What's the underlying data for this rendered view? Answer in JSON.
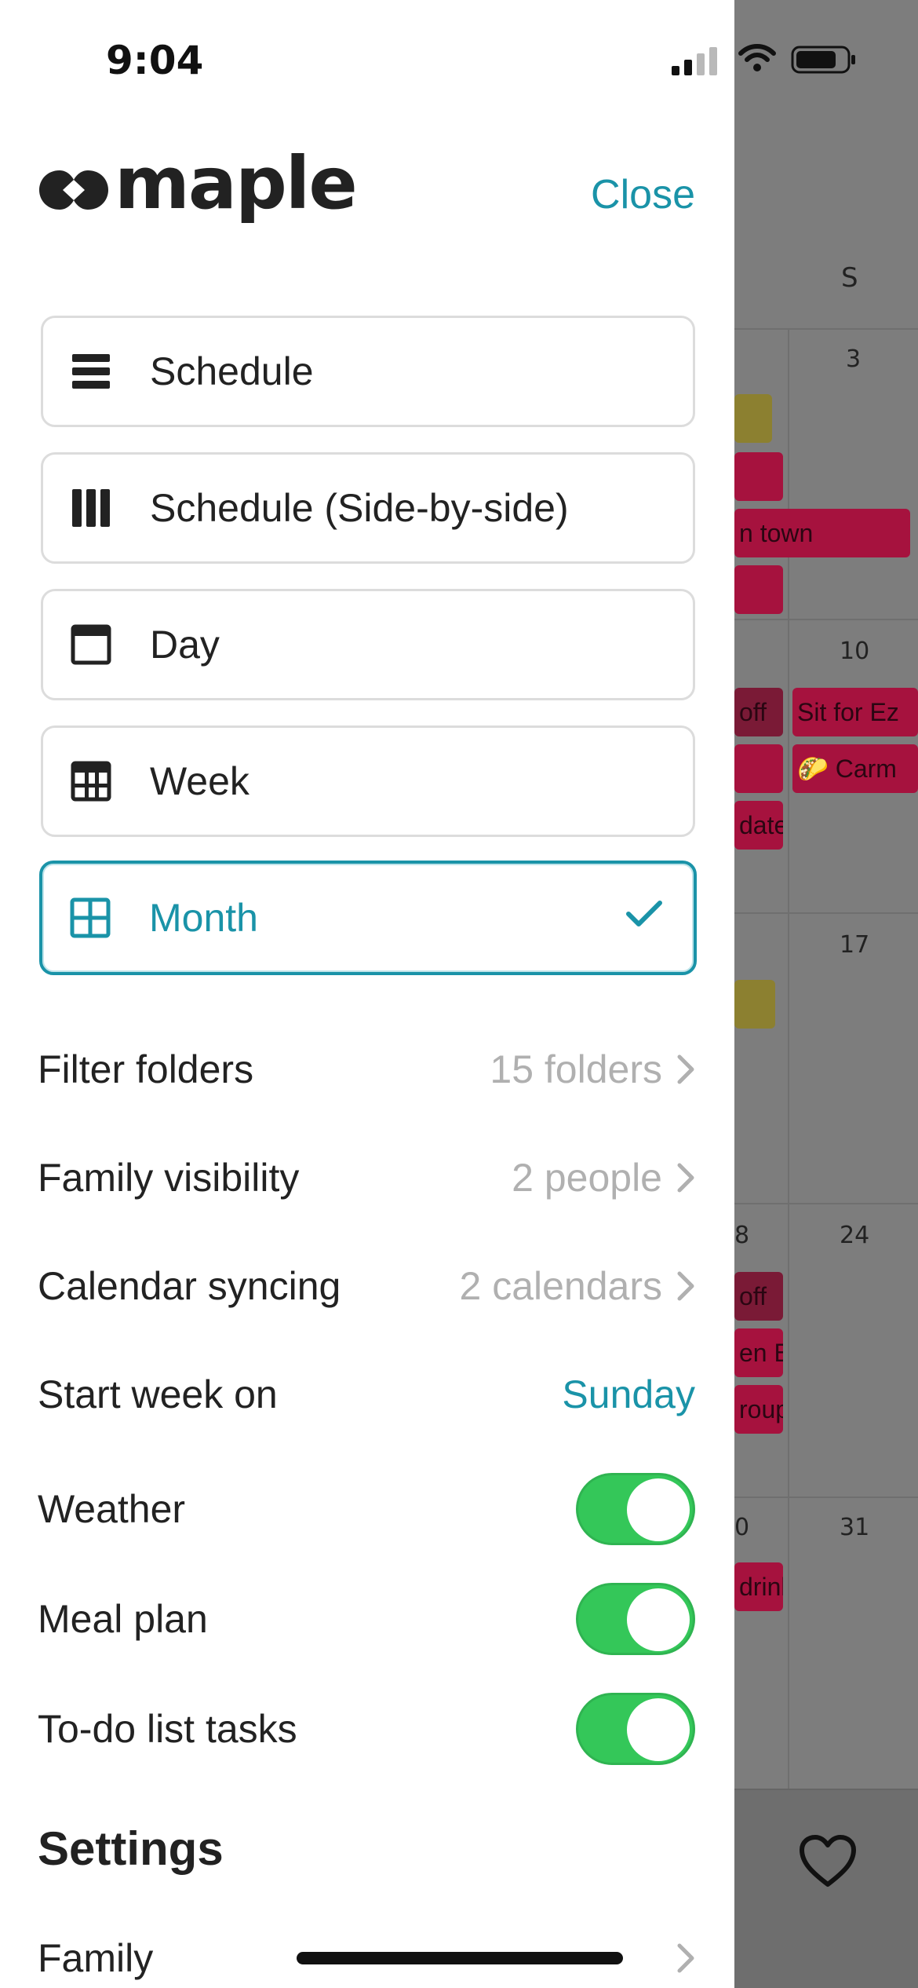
{
  "status_bar": {
    "time": "9:04"
  },
  "brand": {
    "name": "maple"
  },
  "header": {
    "close_label": "Close"
  },
  "views": [
    {
      "label": "Schedule",
      "icon": "list-icon",
      "active": false
    },
    {
      "label": "Schedule (Side-by-side)",
      "icon": "columns-icon",
      "active": false
    },
    {
      "label": "Day",
      "icon": "day-view-icon",
      "active": false
    },
    {
      "label": "Week",
      "icon": "week-view-icon",
      "active": false
    },
    {
      "label": "Month",
      "icon": "month-grid-icon",
      "active": true
    }
  ],
  "options": {
    "filter_folders": {
      "label": "Filter folders",
      "value": "15 folders"
    },
    "family_visibility": {
      "label": "Family visibility",
      "value": "2 people"
    },
    "calendar_syncing": {
      "label": "Calendar syncing",
      "value": "2 calendars"
    },
    "start_week": {
      "label": "Start week on",
      "value": "Sunday"
    },
    "weather": {
      "label": "Weather",
      "on": true
    },
    "meal_plan": {
      "label": "Meal plan",
      "on": true
    },
    "todo": {
      "label": "To-do list tasks",
      "on": true
    }
  },
  "settings": {
    "title": "Settings",
    "family_label": "Family"
  },
  "background_calendar": {
    "day_header": "S",
    "dates": [
      "3",
      "10",
      "17",
      "24",
      "31"
    ],
    "events": [
      {
        "text": "n town"
      },
      {
        "text": "off",
        "tone": "dark"
      },
      {
        "text": "Sit for Ez"
      },
      {
        "text": "🌮 Carm"
      },
      {
        "text": "date"
      },
      {
        "text": "off",
        "tone": "dark"
      },
      {
        "text": "en Bi"
      },
      {
        "text": "roup"
      },
      {
        "text": "drink"
      }
    ],
    "partial_date": "8",
    "partial_date_2": "0"
  },
  "colors": {
    "accent": "#1a93a8",
    "toggle_on": "#34c759",
    "event": "#c2185b",
    "event_yellow": "#d4c24a"
  }
}
